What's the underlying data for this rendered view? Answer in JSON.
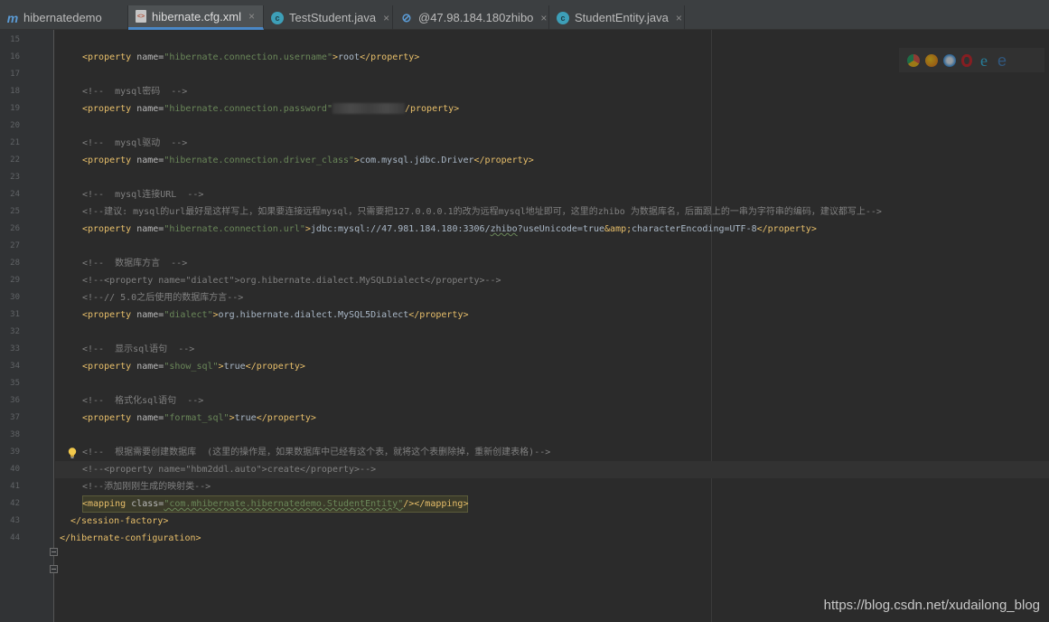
{
  "tabs": [
    {
      "label": "hibernatedemo",
      "icon": "module-m-icon"
    },
    {
      "label": "hibernate.cfg.xml",
      "icon": "xml-file-icon"
    },
    {
      "label": "TestStudent.java",
      "icon": "java-class-icon"
    },
    {
      "label": "@47.98.184.180zhibo",
      "icon": "database-console-icon"
    },
    {
      "label": "StudentEntity.java",
      "icon": "java-class-icon"
    }
  ],
  "close_glyph": "×",
  "line_numbers": [
    "15",
    "16",
    "17",
    "18",
    "19",
    "20",
    "21",
    "22",
    "23",
    "24",
    "25",
    "26",
    "27",
    "28",
    "29",
    "30",
    "31",
    "32",
    "33",
    "34",
    "35",
    "36",
    "37",
    "38",
    "39",
    "40",
    "41",
    "42",
    "43",
    "44"
  ],
  "code": {
    "l16": {
      "t1": "<property ",
      "a1": "name=",
      "v1": "\"hibernate.connection.username\"",
      "t2": ">",
      "x": "root",
      "t3": "</property>"
    },
    "l18": "<!--  mysql密码  -->",
    "l19": {
      "t1": "<property ",
      "a1": "name=",
      "v1": "\"hibernate.connection.password\"",
      "t3": "/property>"
    },
    "l21": "<!--  mysql驱动  -->",
    "l22": {
      "t1": "<property ",
      "a1": "name=",
      "v1": "\"hibernate.connection.driver_class\"",
      "t2": ">",
      "x": "com.mysql.jdbc.Driver",
      "t3": "</property>"
    },
    "l24": "<!--  mysql连接URL  -->",
    "l25": "<!--建议: mysql的url最好是这样写上，如果要连接远程mysql，只需要把127.0.0.0.1的改为远程mysql地址即可，这里的zhibo 为数据库名，后面跟上的一串为字符串的编码，建议都写上-->",
    "l26": {
      "t1": "<property ",
      "a1": "name=",
      "v1": "\"hibernate.connection.url\"",
      "t2": ">",
      "x1": "jdbc:mysql://47.981.184.180:3306/",
      "x2": "zhibo",
      "x3": "?useUnicode=true",
      "x4": "&amp;",
      "x5": "characterEncoding=UTF-8",
      "t3": "</property>"
    },
    "l28": "<!--  数据库方言  -->",
    "l29": "<!--<property name=\"dialect\">org.hibernate.dialect.MySQLDialect</property>-->",
    "l30": "<!--// 5.0之后使用的数据库方言-->",
    "l31": {
      "t1": "<property ",
      "a1": "name=",
      "v1": "\"dialect\"",
      "t2": ">",
      "x": "org.hibernate.dialect.MySQL5Dialect",
      "t3": "</property>"
    },
    "l33": "<!--  显示sql语句  -->",
    "l34": {
      "t1": "<property ",
      "a1": "name=",
      "v1": "\"show_sql\"",
      "t2": ">",
      "x": "true",
      "t3": "</property>"
    },
    "l36": "<!--  格式化sql语句  -->",
    "l37": {
      "t1": "<property ",
      "a1": "name=",
      "v1": "\"format_sql\"",
      "t2": ">",
      "x": "true",
      "t3": "</property>"
    },
    "l39": "<!--  根据需要创建数据库  (这里的操作是，如果数据库中已经有这个表，就将这个表删除掉，重新创建表格)-->",
    "l40": "<!--<property name=\"hbm2ddl.auto\">create</property>-->",
    "l41": "<!--添加刚刚生成的映射类-->",
    "l42": {
      "t1": "<mapping ",
      "a1": "class=",
      "v1": "\"com.mhibernate.hibernatedemo.StudentEntity\"",
      "t3": "/></mapping>"
    },
    "l43": "</session-factory>",
    "l44": "</hibernate-configuration>"
  },
  "browser_icons": [
    "chrome-icon",
    "firefox-icon",
    "safari-icon",
    "opera-icon",
    "ie-icon",
    "edge-icon"
  ],
  "watermark": "https://blog.csdn.net/xudailong_blog"
}
